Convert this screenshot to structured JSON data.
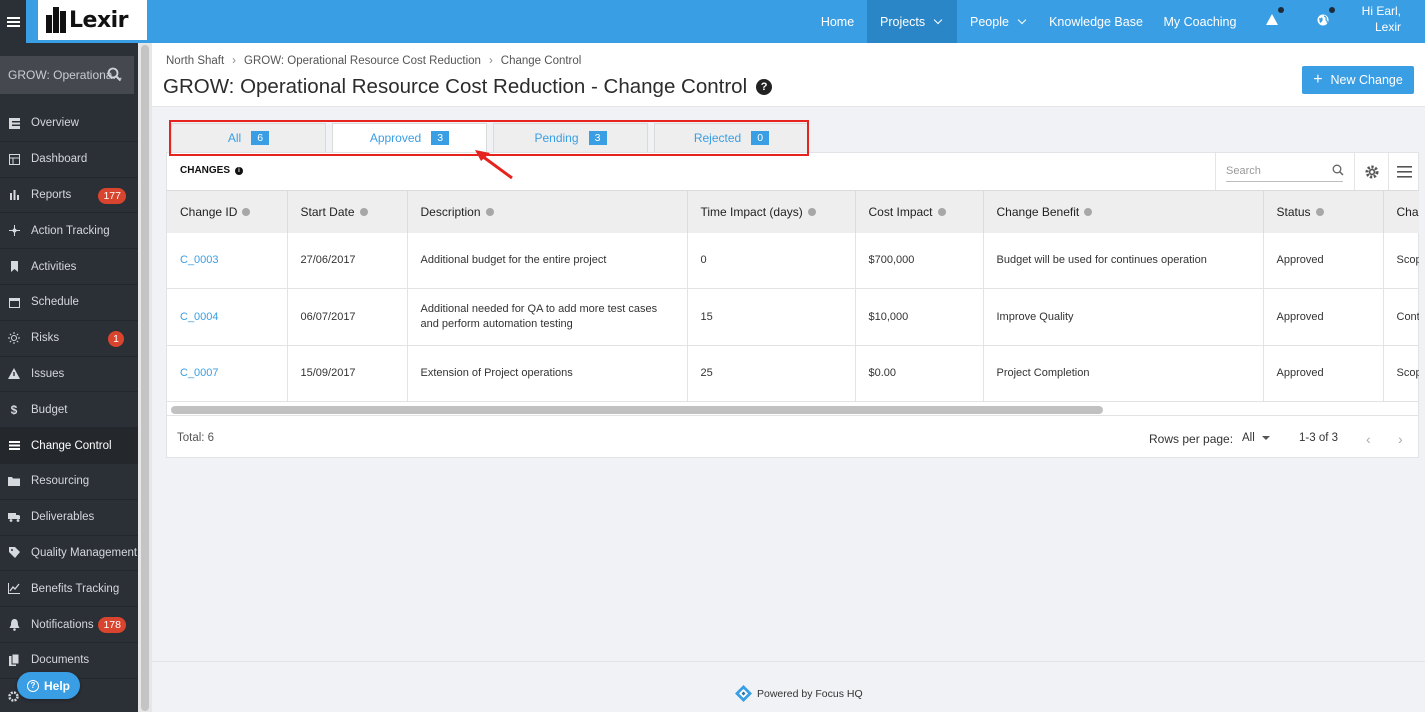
{
  "topbar": {
    "logo_text": "Lexir",
    "nav": [
      {
        "label": "Home"
      },
      {
        "label": "Projects"
      },
      {
        "label": "People"
      },
      {
        "label": "Knowledge Base"
      },
      {
        "label": "My Coaching"
      }
    ],
    "greeting_line1": "Hi Earl,",
    "greeting_line2": "Lexir"
  },
  "sidebar": {
    "project_search": "GROW: Operationa...",
    "items": [
      {
        "label": "Overview",
        "icon": "overview-icon"
      },
      {
        "label": "Dashboard",
        "icon": "dashboard-icon"
      },
      {
        "label": "Reports",
        "icon": "reports-icon",
        "badge": "177"
      },
      {
        "label": "Action Tracking",
        "icon": "action-tracking-icon"
      },
      {
        "label": "Activities",
        "icon": "activities-icon"
      },
      {
        "label": "Schedule",
        "icon": "schedule-icon"
      },
      {
        "label": "Risks",
        "icon": "risks-icon",
        "badge": "1"
      },
      {
        "label": "Issues",
        "icon": "issues-icon"
      },
      {
        "label": "Budget",
        "icon": "budget-icon"
      },
      {
        "label": "Change Control",
        "icon": "change-control-icon"
      },
      {
        "label": "Resourcing",
        "icon": "resourcing-icon"
      },
      {
        "label": "Deliverables",
        "icon": "deliverables-icon"
      },
      {
        "label": "Quality Management",
        "icon": "quality-icon"
      },
      {
        "label": "Benefits Tracking",
        "icon": "benefits-icon"
      },
      {
        "label": "Notifications",
        "icon": "notifications-icon",
        "badge": "178"
      },
      {
        "label": "Documents",
        "icon": "documents-icon"
      }
    ],
    "help_label": "Help"
  },
  "header": {
    "breadcrumb": [
      "North Shaft",
      "GROW: Operational Resource Cost Reduction",
      "Change Control"
    ],
    "title": "GROW: Operational Resource Cost Reduction - Change Control",
    "new_change_label": "New Change"
  },
  "tabs": [
    {
      "label": "All",
      "count": "6"
    },
    {
      "label": "Approved",
      "count": "3"
    },
    {
      "label": "Pending",
      "count": "3"
    },
    {
      "label": "Rejected",
      "count": "0"
    }
  ],
  "panel": {
    "title": "CHANGES",
    "search_placeholder": "Search",
    "columns": [
      "Change ID",
      "Start Date",
      "Description",
      "Time Impact (days)",
      "Cost Impact",
      "Change Benefit",
      "Status",
      "Change Type"
    ],
    "rows": [
      [
        "C_0003",
        "27/06/2017",
        "Additional budget for the entire project",
        "0",
        "$700,000",
        "Budget will be used for continues operation",
        "Approved",
        "Scope"
      ],
      [
        "C_0004",
        "06/07/2017",
        "Additional needed for QA to add more test cases and perform automation testing",
        "15",
        "$10,000",
        "Improve Quality",
        "Approved",
        "Contract"
      ],
      [
        "C_0007",
        "15/09/2017",
        "Extension of Project operations",
        "25",
        "$0.00",
        "Project Completion",
        "Approved",
        "Scope"
      ]
    ],
    "total": "Total: 6",
    "rows_per_page_label": "Rows per page:",
    "rows_per_page_value": "All",
    "range": "1-3 of 3"
  },
  "footer": {
    "powered_by": "Powered by Focus HQ"
  },
  "colors": {
    "accent": "#3a9ee4",
    "sidebar": "#2b2f36",
    "badge": "#d9442e",
    "highlight": "#e5231f"
  }
}
